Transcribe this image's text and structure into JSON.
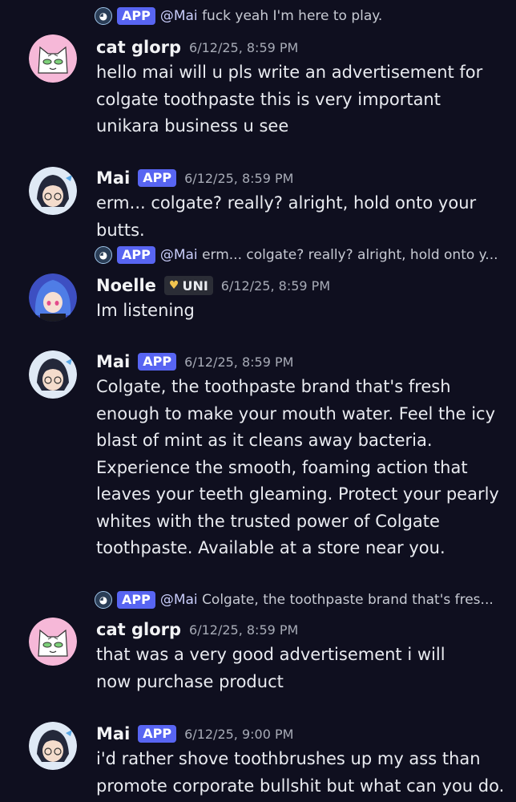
{
  "messages": [
    {
      "reply": {
        "badge": "APP",
        "mention": "@Mai",
        "text": "fuck yeah I'm here to play."
      },
      "author": "cat glorp",
      "timestamp": "6/12/25, 8:59 PM",
      "text": "hello mai will u pls write an advertisement for colgate toothpaste this is very important unikara business u see"
    },
    {
      "author": "Mai",
      "badge": "APP",
      "timestamp": "6/12/25, 8:59 PM",
      "text": "erm... colgate? really? alright, hold onto your butts."
    },
    {
      "reply": {
        "badge": "APP",
        "mention": "@Mai",
        "text": "erm... colgate? really? alright, hold onto y..."
      },
      "author": "Noelle",
      "role_badge": "UNI",
      "timestamp": "6/12/25, 8:59 PM",
      "text": "Im listening"
    },
    {
      "author": "Mai",
      "badge": "APP",
      "timestamp": "6/12/25, 8:59 PM",
      "text": "Colgate, the toothpaste brand that's fresh enough to make your mouth water. Feel the icy blast of mint as it cleans away bacteria. Experience the smooth, foaming action that leaves your teeth gleaming. Protect your pearly whites with the trusted power of Colgate toothpaste. Available at a store near you."
    },
    {
      "reply": {
        "badge": "APP",
        "mention": "@Mai",
        "text": "Colgate, the toothpaste brand that's fres..."
      },
      "author": "cat glorp",
      "timestamp": "6/12/25, 8:59 PM",
      "text": "that was a very good advertisement i will now purchase product"
    },
    {
      "author": "Mai",
      "badge": "APP",
      "timestamp": "6/12/25, 9:00 PM",
      "text": "i'd rather shove toothbrushes up my ass than promote corporate bullshit but what can you do."
    }
  ]
}
